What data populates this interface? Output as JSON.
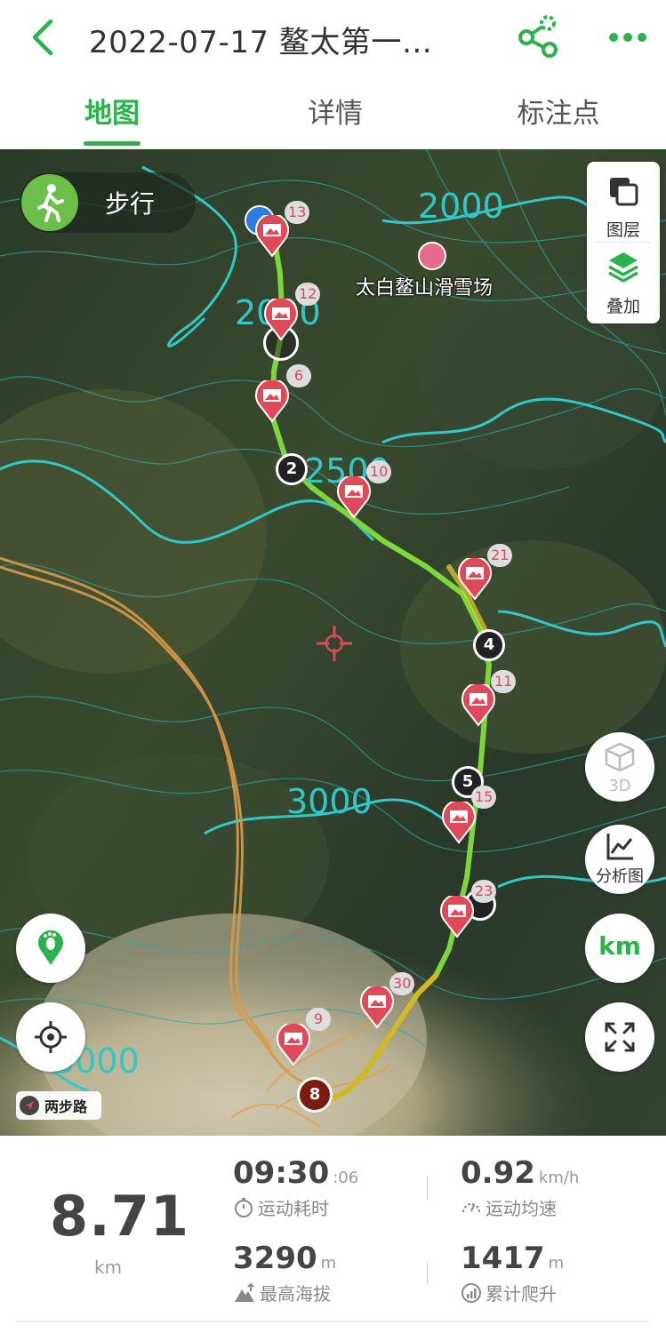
{
  "header": {
    "title": "2022-07-17 鳌太第一…",
    "back_icon": "back-chevron-icon",
    "share_icon": "share-icon",
    "more_icon": "more-dots-icon",
    "accent_color": "#2bb24c"
  },
  "tabs": [
    {
      "label": "地图",
      "active": true
    },
    {
      "label": "详情",
      "active": false
    },
    {
      "label": "标注点",
      "active": false
    }
  ],
  "map": {
    "mode_label": "步行",
    "layers_label": "图层",
    "overlay_label": "叠加",
    "poi_label": "太白鳌山滑雪场",
    "contour_labels": [
      "2000",
      "2000",
      "2500",
      "3000",
      "3000"
    ],
    "photo_markers": [
      "13",
      "12",
      "6",
      "10",
      "21",
      "11",
      "15",
      "23",
      "30",
      "9"
    ],
    "km_markers": [
      "2",
      "4",
      "5",
      "8"
    ],
    "btn_3d_label": "3D",
    "btn_analysis_label": "分析图",
    "btn_unit_label": "km",
    "legend_label": "两步路",
    "route_color": "#7cd83a",
    "contour_color": "#2ec8c8",
    "photo_marker_color": "#e0495a"
  },
  "stats": {
    "distance": "8.71",
    "distance_unit": "km",
    "duration_main": "09:30",
    "duration_sec": ":06",
    "duration_label": "运动耗时",
    "speed": "0.92",
    "speed_unit": "km/h",
    "speed_label": "运动均速",
    "max_alt": "3290",
    "max_alt_unit": "m",
    "max_alt_label": "最高海拔",
    "climb": "1417",
    "climb_unit": "m",
    "climb_label": "累计爬升"
  }
}
